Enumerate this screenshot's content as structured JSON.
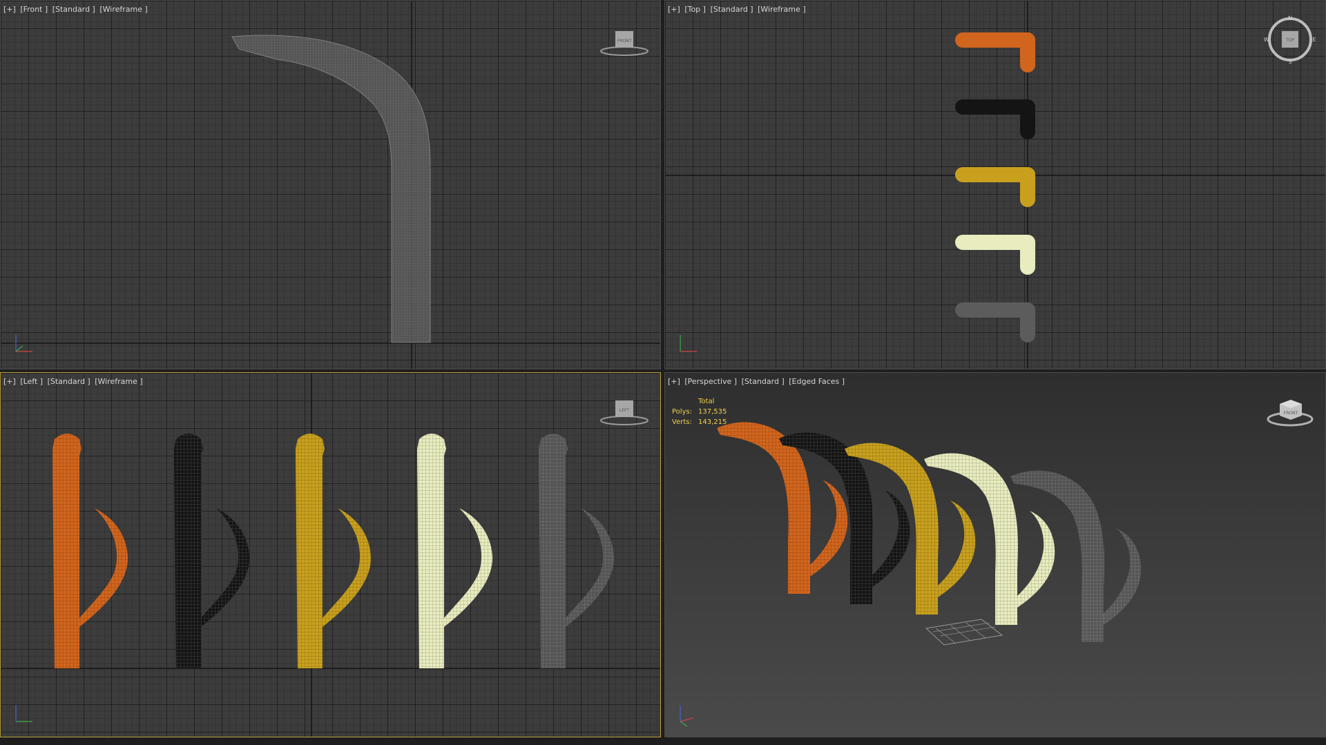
{
  "viewports": {
    "front": {
      "plus": "[+]",
      "name": "[Front ]",
      "shading": "[Standard ]",
      "mode": "[Wireframe ]",
      "cube_label": "FRONT"
    },
    "top": {
      "plus": "[+]",
      "name": "[Top ]",
      "shading": "[Standard ]",
      "mode": "[Wireframe ]",
      "cube_label": "TOP",
      "compass": {
        "n": "N",
        "e": "E",
        "s": "S",
        "w": "W"
      }
    },
    "left": {
      "plus": "[+]",
      "name": "[Left ]",
      "shading": "[Standard ]",
      "mode": "[Wireframe ]",
      "cube_label": "LEFT"
    },
    "perspective": {
      "plus": "[+]",
      "name": "[Perspective ]",
      "shading": "[Standard ]",
      "mode": "[Edged Faces ]",
      "cube_label": "FRONT"
    }
  },
  "stats": {
    "header": "Total",
    "polys_label": "Polys:",
    "polys_value": "137,535",
    "verts_label": "Verts:",
    "verts_value": "143,215"
  },
  "axis_labels": {
    "x": "x",
    "y": "y",
    "z": "z"
  },
  "colors": {
    "active_border": "#b9a23c",
    "orange": "#d2651d",
    "black": "#141414",
    "gold": "#c9a01e",
    "cream": "#e8ecbe",
    "gray": "#6a6a6a",
    "stats_text": "#f1d24a"
  },
  "models": [
    "orange",
    "black",
    "gold",
    "cream",
    "gray"
  ]
}
